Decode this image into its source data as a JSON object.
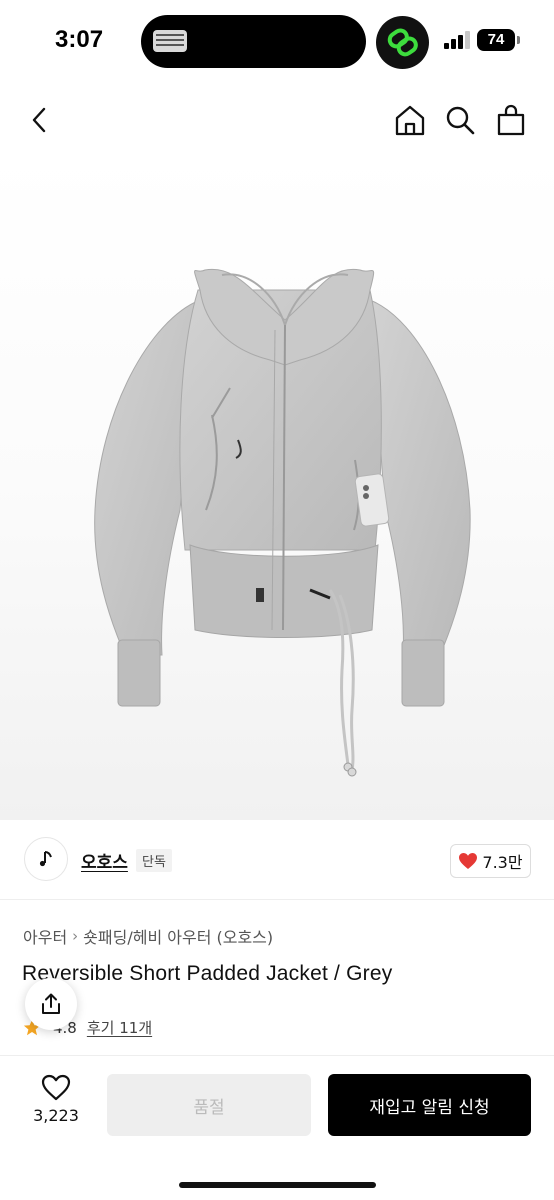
{
  "status_bar": {
    "time": "3:07",
    "battery": "74"
  },
  "nav": {
    "back_icon": "chevron-left-icon",
    "home_icon": "home-icon",
    "search_icon": "search-icon",
    "cart_icon": "shopping-bag-icon"
  },
  "brand": {
    "name": "오호스",
    "badge": "단독",
    "likes": "7.3만"
  },
  "breadcrumb": {
    "category": "아우터",
    "subcategory": "숏패딩/헤비 아우터 (오호스)"
  },
  "product": {
    "title": "Reversible Short Padded Jacket / Grey",
    "rating": "4.8",
    "reviews": "후기 11개"
  },
  "bottom_bar": {
    "wish_count": "3,223",
    "soldout_label": "품절",
    "restock_label": "재입고 알림 신청"
  },
  "colors": {
    "heart": "#e53935",
    "app_badge_green": "#3ddc3d",
    "jacket_grey": "#c6c6c6",
    "star": "#f5a623"
  }
}
